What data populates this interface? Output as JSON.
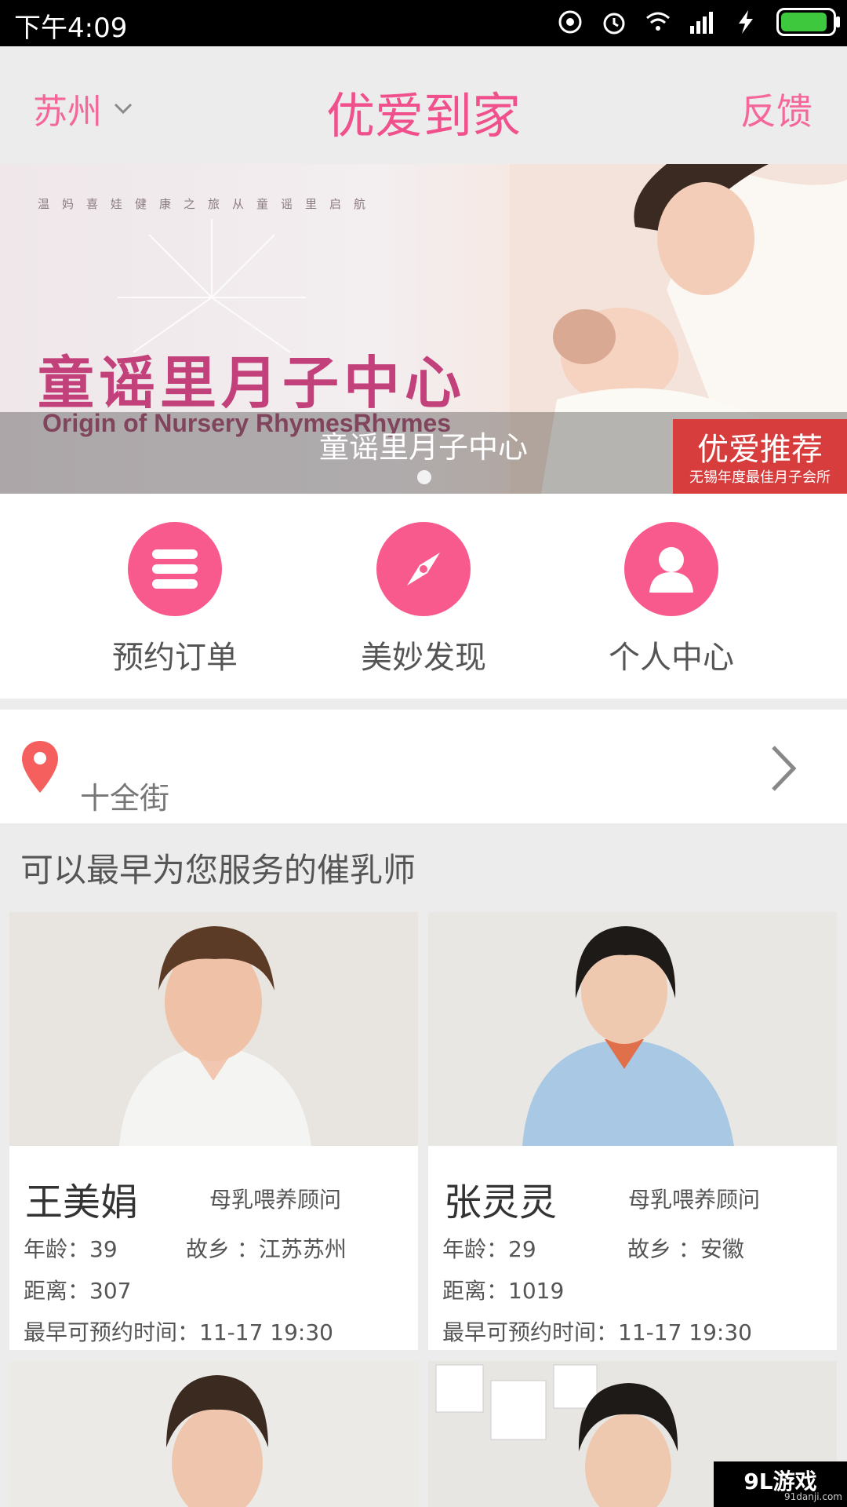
{
  "status_bar": {
    "time": "下午4:09"
  },
  "header": {
    "city": "苏州",
    "title": "优爱到家",
    "feedback": "反馈"
  },
  "banner": {
    "tagline": "温妈喜娃健康之旅从童谣里启航",
    "logo_cn": "童谣里月子中心",
    "logo_en": "Origin of Nursery RhymesRhymes",
    "caption": "童谣里月子中心",
    "recommend_title": "优爱推荐",
    "recommend_sub": "无锡年度最佳月子会所"
  },
  "menu": [
    {
      "label": "预约订单",
      "icon": "list-icon"
    },
    {
      "label": "美妙发现",
      "icon": "compass-icon"
    },
    {
      "label": "个人中心",
      "icon": "person-icon"
    }
  ],
  "location": {
    "address": "十全街"
  },
  "section_title": "可以最早为您服务的催乳师",
  "cards": [
    {
      "name": "王美娟",
      "role": "母乳喂养顾问",
      "age_label": "年龄：",
      "age": "39",
      "hometown_label": "故乡 ：",
      "hometown": "江苏苏州",
      "distance_label": "距离：",
      "distance": "307",
      "time_label": "最早可预约时间：",
      "time": "11-17 19:30"
    },
    {
      "name": "张灵灵",
      "role": "母乳喂养顾问",
      "age_label": "年龄：",
      "age": "29",
      "hometown_label": "故乡 ：",
      "hometown": "安徽",
      "distance_label": "距离：",
      "distance": "1019",
      "time_label": "最早可预约时间：",
      "time": "11-17 19:30"
    }
  ],
  "watermark": {
    "line1": "9L游戏",
    "line2": "91danji.com"
  },
  "colors": {
    "accent": "#f95a8d",
    "title": "#f0508c"
  }
}
